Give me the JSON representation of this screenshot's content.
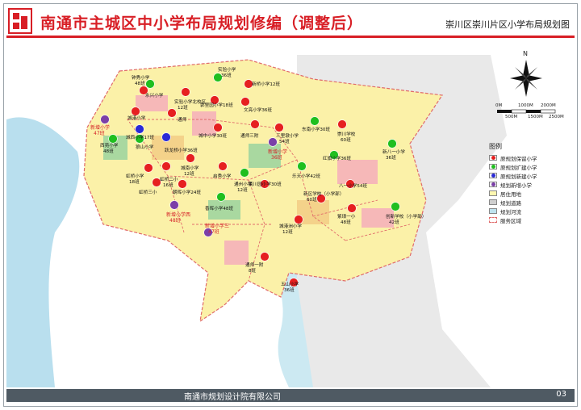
{
  "header": {
    "title": "南通市主城区中小学布局规划修编（调整后）",
    "subtitle": "崇川区崇川片区小学布局规划图"
  },
  "footer": {
    "organization": "南通市规划设计院有限公司",
    "page": "03"
  },
  "compass": {
    "north_label": "N"
  },
  "scale": {
    "labels_top": [
      "0M",
      "1000M",
      "2000M"
    ],
    "labels_bottom": [
      "500M",
      "1500M",
      "2500M"
    ]
  },
  "legend": {
    "title": "图例",
    "items": [
      {
        "label": "原规划保留小学",
        "color": "#e62020",
        "type": "dot"
      },
      {
        "label": "原规划扩建小学",
        "color": "#1fbf1f",
        "type": "dot"
      },
      {
        "label": "原规划新建小学",
        "color": "#2a2ad6",
        "type": "dot"
      },
      {
        "label": "规划新增小学",
        "color": "#7b3fa8",
        "type": "dot"
      },
      {
        "label": "居住用地",
        "color": "#fff7b0",
        "type": "fill"
      },
      {
        "label": "规划道路",
        "color": "#cfcfcf",
        "type": "fill"
      },
      {
        "label": "规划河流",
        "color": "#bfe3ef",
        "type": "fill"
      },
      {
        "label": "服务区域",
        "color": "#e06a6a",
        "type": "dash"
      }
    ]
  },
  "schools": [
    {
      "name": "钟秀小学",
      "sub": "48班",
      "kind": "expand"
    },
    {
      "name": "实验小学",
      "sub": "36班",
      "kind": "expand"
    },
    {
      "name": "新桥小学12班",
      "sub": "",
      "kind": "keep"
    },
    {
      "name": "实验小学北校区",
      "sub": "12班",
      "kind": "keep"
    },
    {
      "name": "永兴小学",
      "sub": "",
      "kind": "keep"
    },
    {
      "name": "郭里园小学18班",
      "sub": "",
      "kind": "keep"
    },
    {
      "name": "文亮小学36班",
      "sub": "",
      "kind": "keep"
    },
    {
      "name": "城港小学",
      "sub": "",
      "kind": "keep"
    },
    {
      "name": "通师",
      "sub": "",
      "kind": "keep"
    },
    {
      "name": "城西小学17班",
      "sub": "",
      "kind": "new"
    },
    {
      "name": "新增小学",
      "sub": "47班",
      "kind": "added"
    },
    {
      "name": "城中小学30班",
      "sub": "",
      "kind": "keep"
    },
    {
      "name": "通师三附",
      "sub": "",
      "kind": "keep"
    },
    {
      "name": "三里墩小学",
      "sub": "54班",
      "kind": "keep"
    },
    {
      "name": "东南小学30班",
      "sub": "",
      "kind": "expand"
    },
    {
      "name": "崇川学校",
      "sub": "60班",
      "kind": "keep"
    },
    {
      "name": "西苑小学",
      "sub": "48班",
      "kind": "expand"
    },
    {
      "name": "狼山小学",
      "sub": "",
      "kind": "expand"
    },
    {
      "name": "跃龙桥小学36班",
      "sub": "",
      "kind": "new"
    },
    {
      "name": "新增小学",
      "sub": "36班",
      "kind": "added"
    },
    {
      "name": "红旗小学36班",
      "sub": "",
      "kind": "expand"
    },
    {
      "name": "新八一小学",
      "sub": "36班",
      "kind": "expand"
    },
    {
      "name": "虹桥小学",
      "sub": "18班",
      "kind": "keep"
    },
    {
      "name": "虹桥二小",
      "sub": "16班",
      "kind": "keep"
    },
    {
      "name": "城南小学",
      "sub": "12班",
      "kind": "keep"
    },
    {
      "name": "启秀小学",
      "sub": "",
      "kind": "keep"
    },
    {
      "name": "通州小学",
      "sub": "12班",
      "kind": "expand"
    },
    {
      "name": "乐天小学42班",
      "sub": "",
      "kind": "expand"
    },
    {
      "name": "南川园小学30班",
      "sub": "",
      "kind": "keep"
    },
    {
      "name": "八一小学54班",
      "sub": "",
      "kind": "keep"
    },
    {
      "name": "虹桥三小",
      "sub": "",
      "kind": "keep"
    },
    {
      "name": "朝晖小学24班",
      "sub": "",
      "kind": "keep"
    },
    {
      "name": "新区学校（小学部）",
      "sub": "60班",
      "kind": "keep"
    },
    {
      "name": "新增小学西",
      "sub": "48班",
      "kind": "added"
    },
    {
      "name": "香晖小学48班",
      "sub": "",
      "kind": "expand"
    },
    {
      "name": "紫琅一小",
      "sub": "48班",
      "kind": "keep"
    },
    {
      "name": "创新学校（小学部）",
      "sub": "42班",
      "kind": "expand"
    },
    {
      "name": "新增小学三",
      "sub": "47班",
      "kind": "added"
    },
    {
      "name": "城港洲小学",
      "sub": "12班",
      "kind": "keep"
    },
    {
      "name": "通师一附",
      "sub": "8班",
      "kind": "keep"
    },
    {
      "name": "五山小学",
      "sub": "36班",
      "kind": "keep"
    }
  ]
}
